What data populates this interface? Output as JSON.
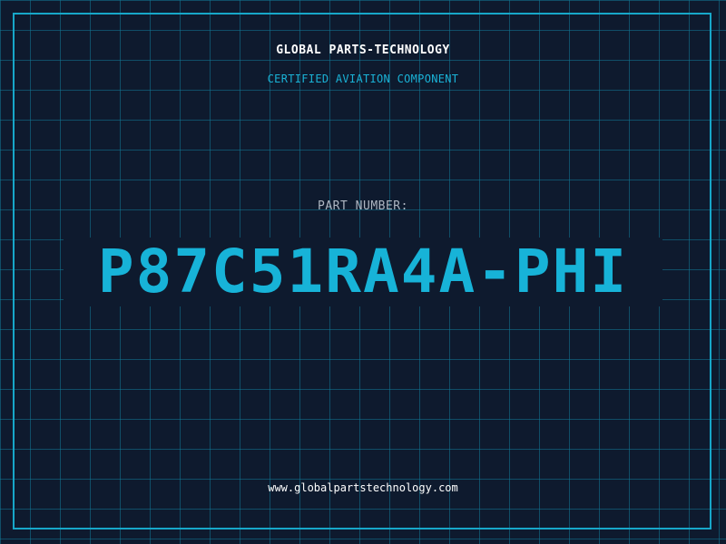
{
  "card": {
    "company": "GLOBAL PARTS-TECHNOLOGY",
    "subtitle": "CERTIFIED AVIATION COMPONENT",
    "label": "PART NUMBER:",
    "part_number": "P87C51RA4A-PHI",
    "website": "www.globalpartstechnology.com"
  },
  "colors": {
    "background": "#0e1a2e",
    "grid": "#12789a",
    "accent": "#17a7c9",
    "text_primary": "#ffffff",
    "text_muted": "#aeb6c2"
  }
}
